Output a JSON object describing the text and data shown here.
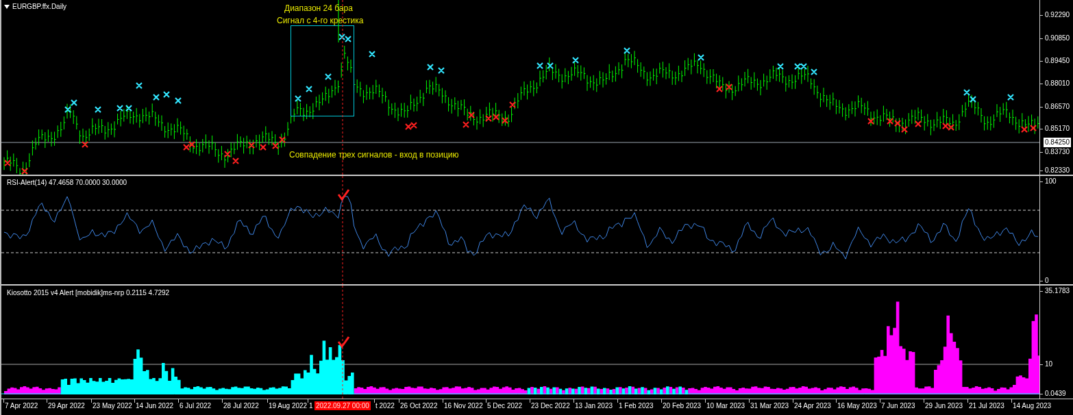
{
  "chart": {
    "title": "EURGBP.ffx.Daily",
    "annotations": [
      {
        "text": "Диапазон 24 бара"
      },
      {
        "text": "Сигнал с 4-го крестика"
      },
      {
        "text": "Совпадение трех сигналов - вход в позицию"
      }
    ],
    "price_axis": [
      "0.92290",
      "0.90850",
      "0.89450",
      "0.88010",
      "0.86570",
      "0.85170",
      "0.83730",
      "0.82330"
    ],
    "current_price": "0.84250"
  },
  "rsi": {
    "title": "RSI-Alert(14) 47.4658 70.0000 30.0000",
    "axis": [
      "100",
      "0"
    ]
  },
  "kiosotto": {
    "title": "Kiosotto 2015 v4 Alert [mobidik]ms-nrp 0.2115 4.7292",
    "axis": [
      "35.1783",
      "10",
      "0.0439"
    ]
  },
  "time_axis": {
    "labels": [
      "7 Apr 2022",
      "29 Apr 2022",
      "23 May 2022",
      "14 Jun 2022",
      "6 Jul 2022",
      "28 Jul 2022",
      "19 Aug 2022",
      "1",
      "t 2022",
      "26 Oct 2022",
      "16 Nov 2022",
      "5 Dec 2022",
      "23 Dec 2022",
      "13 Jan 2023",
      "1 Feb 2023",
      "20 Feb 2023",
      "10 Mar 2023",
      "31 Mar 2023",
      "24 Apr 2023",
      "16 May 2023",
      "7 Jun 2023",
      "29 Jun 2023",
      "21 Jul 2023",
      "14 Aug 2023"
    ],
    "crosshair_label": "2022.09.27 00:00"
  }
}
